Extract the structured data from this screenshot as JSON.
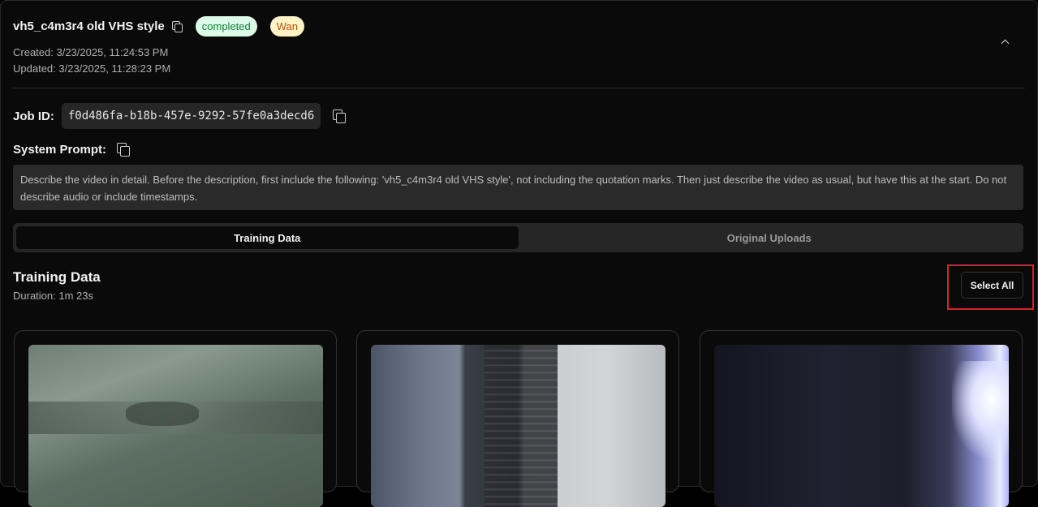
{
  "job": {
    "name": "vh5_c4m3r4 old VHS style",
    "status": "completed",
    "model": "Wan",
    "created": "Created: 3/23/2025, 11:24:53 PM",
    "updated": "Updated: 3/23/2025, 11:28:23 PM",
    "job_id_label": "Job ID:",
    "job_id": "f0d486fa-b18b-457e-9292-57fe0a3decd6",
    "system_prompt_label": "System Prompt:",
    "system_prompt": "Describe the video in detail. Before the description, first include the following: 'vh5_c4m3r4 old VHS style', not including the quotation marks. Then just describe the video as usual, but have this at the start. Do not describe audio or include timestamps."
  },
  "tabs": [
    {
      "label": "Training Data",
      "active": true
    },
    {
      "label": "Original Uploads",
      "active": false
    }
  ],
  "section": {
    "title": "Training Data",
    "duration": "Duration: 1m 23s",
    "select_all_label": "Select All"
  },
  "colors": {
    "completed_bg": "#dcfce7",
    "completed_text": "#15803d",
    "model_bg": "#fef3c7",
    "model_text": "#b45309",
    "highlight": "#e11d2a"
  },
  "icons": [
    "copy-icon",
    "chevron-up-icon"
  ]
}
